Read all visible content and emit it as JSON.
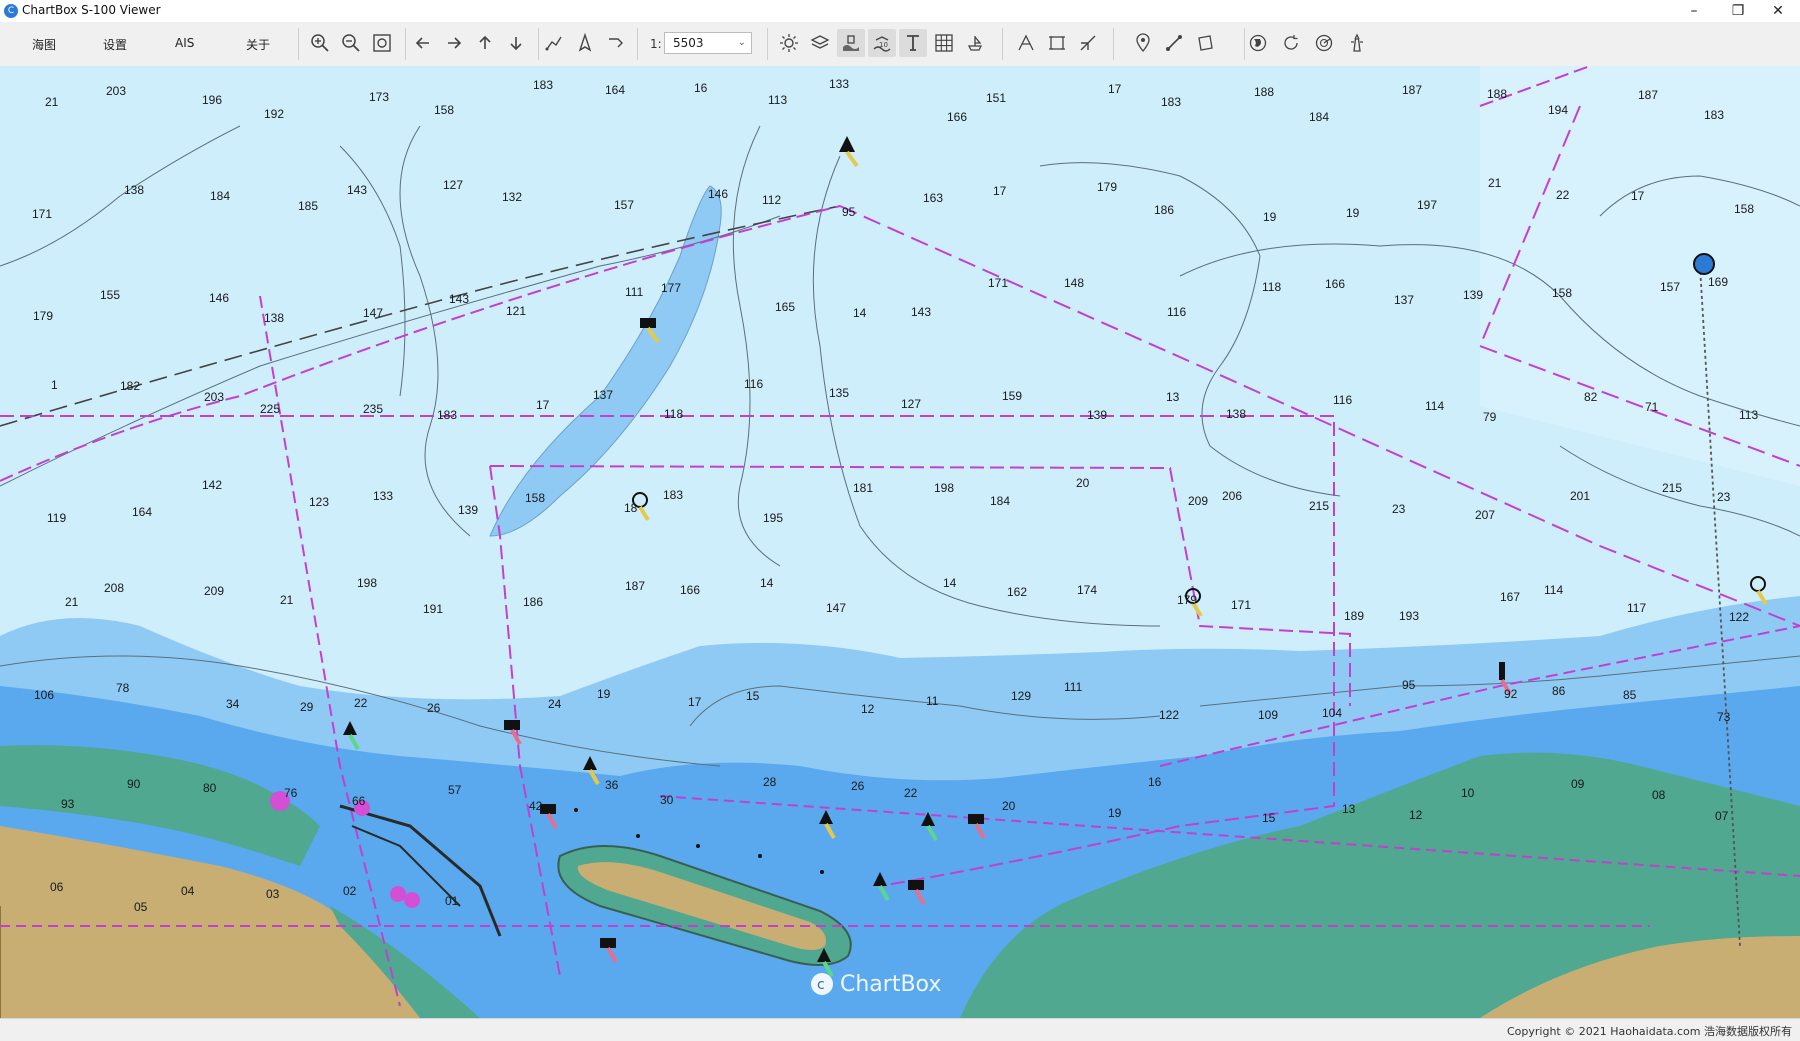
{
  "window": {
    "title": "ChartBox S-100 Viewer",
    "icon": "app-logo-icon",
    "controls": [
      "minimize-icon",
      "restore-icon",
      "close-icon"
    ]
  },
  "menu": [
    {
      "label": "海图"
    },
    {
      "label": "设置"
    },
    {
      "label": "AIS"
    },
    {
      "label": "关于"
    }
  ],
  "toolbar": {
    "groups": [
      [
        "zoom-in-icon",
        "zoom-out-icon",
        "zoom-extent-icon"
      ],
      [
        "pan-left-icon",
        "pan-right-icon",
        "pan-up-icon",
        "pan-down-icon"
      ],
      [
        "route-icon",
        "ship-icon",
        "track-icon"
      ],
      [
        "brightness-icon",
        "layers-icon",
        "depth-area-icon",
        "depth-contour-icon",
        "text-icon",
        "grid-icon",
        "ship-symbol-icon"
      ],
      [
        "measure-icon",
        "select-area-icon",
        "tools-icon"
      ],
      [
        "pin-icon",
        "line-icon",
        "polygon-icon"
      ],
      [
        "globe-icon",
        "refresh-icon",
        "radar-icon",
        "lighthouse-icon"
      ]
    ],
    "active": [
      "depth-area-icon",
      "depth-contour-icon",
      "text-icon"
    ],
    "scale_prefix": "1:",
    "scale_value": "5503"
  },
  "map": {
    "watermark": "ChartBox",
    "soundings": [
      "21",
      "203",
      "196",
      "192",
      "173",
      "158",
      "183",
      "164",
      "16",
      "113",
      "133",
      "166",
      "151",
      "17",
      "183",
      "188",
      "184",
      "187",
      "188",
      "194",
      "187",
      "183",
      "171",
      "138",
      "184",
      "185",
      "143",
      "127",
      "132",
      "157",
      "146",
      "112",
      "95",
      "163",
      "17",
      "179",
      "186",
      "19",
      "19",
      "197",
      "21",
      "22",
      "17",
      "158",
      "179",
      "155",
      "146",
      "138",
      "147",
      "143",
      "121",
      "111",
      "177",
      "165",
      "14",
      "143",
      "171",
      "148",
      "116",
      "118",
      "166",
      "137",
      "139",
      "158",
      "157",
      "169",
      "1",
      "182",
      "203",
      "225",
      "235",
      "183",
      "17",
      "137",
      "118",
      "116",
      "135",
      "127",
      "159",
      "139",
      "13",
      "138",
      "116",
      "114",
      "79",
      "82",
      "71",
      "113",
      "119",
      "164",
      "142",
      "123",
      "133",
      "139",
      "158",
      "18",
      "183",
      "195",
      "181",
      "198",
      "184",
      "20",
      "209",
      "206",
      "215",
      "23",
      "207",
      "201",
      "215",
      "23",
      "21",
      "208",
      "209",
      "21",
      "198",
      "191",
      "186",
      "187",
      "166",
      "14",
      "147",
      "14",
      "162",
      "174",
      "179",
      "171",
      "189",
      "193",
      "167",
      "114",
      "117",
      "122",
      "106",
      "78",
      "34",
      "29",
      "22",
      "26",
      "24",
      "19",
      "17",
      "15",
      "12",
      "11",
      "129",
      "111",
      "122",
      "109",
      "104",
      "95",
      "92",
      "86",
      "85",
      "73",
      "93",
      "90",
      "80",
      "76",
      "66",
      "57",
      "42",
      "36",
      "30",
      "28",
      "26",
      "22",
      "20",
      "19",
      "16",
      "15",
      "13",
      "12",
      "10",
      "09",
      "08",
      "07",
      "06",
      "05",
      "04",
      "03",
      "02",
      "01"
    ],
    "copyright": "Copyright © 2021 Haohaidata.com 浩海数据版权所有"
  },
  "colors": {
    "deep_water": "#cfeefc",
    "medium_water": "#8fcaf5",
    "shallow_water": "#5aa9ee",
    "land": "#c9ae74",
    "intertidal": "#4fa88f",
    "boundary": "#c33fd1"
  }
}
